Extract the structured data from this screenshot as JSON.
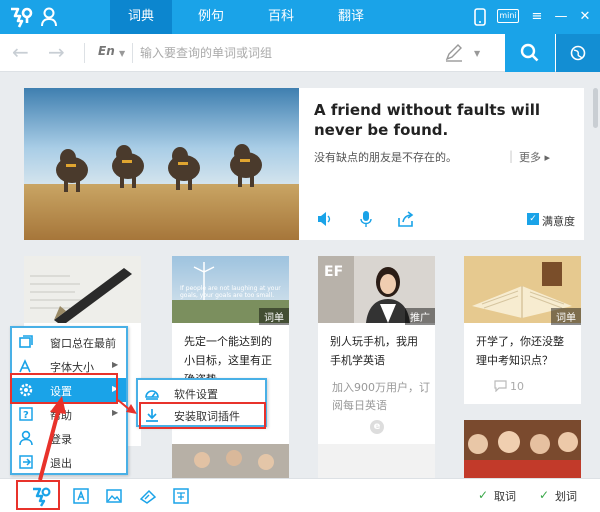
{
  "header": {
    "tabs": [
      {
        "label": "词典",
        "active": true
      },
      {
        "label": "例句",
        "active": false
      },
      {
        "label": "百科",
        "active": false
      },
      {
        "label": "翻译",
        "active": false
      }
    ],
    "mini_label": "mini",
    "minimize": "—",
    "close": "✕",
    "accent": "#1aa3e8"
  },
  "search": {
    "lang": "En",
    "placeholder": "输入要查询的单词或词组"
  },
  "feature": {
    "english": "A friend without faults will never be found.",
    "chinese": "没有缺点的朋友是不存在的。",
    "separator": "|",
    "more": "更多 ▸",
    "satisfaction": "满意度",
    "icons": [
      "speaker-icon",
      "microphone-icon",
      "share-icon"
    ]
  },
  "cards": [
    {
      "tag": "",
      "title": "",
      "sub": "",
      "count": ""
    },
    {
      "tag": "词单",
      "title": "先定一个能达到的小目标，这里有正确姿势",
      "sub": "",
      "count": "",
      "image_text": "If people are not laughing at your goals, your goals are too small."
    },
    {
      "tag": "推广",
      "title": "别人玩手机，我用手机学英语",
      "sub": "加入900万用户，订阅每日英语",
      "count": "",
      "image_text": "EF"
    },
    {
      "tag": "词单",
      "title": "开学了，你还没整理中考知识点？",
      "sub": "",
      "count": "10"
    }
  ],
  "context_menu": {
    "items": [
      {
        "label": "窗口总在最前",
        "icon": "window-icon",
        "arrow": false
      },
      {
        "label": "字体大小",
        "icon": "font-size-icon",
        "arrow": true
      },
      {
        "label": "设置",
        "icon": "gear-icon",
        "arrow": true,
        "highlighted": true
      },
      {
        "label": "帮助",
        "icon": "help-icon",
        "arrow": true
      },
      {
        "label": "登录",
        "icon": "user-icon",
        "arrow": false
      },
      {
        "label": "退出",
        "icon": "exit-icon",
        "arrow": false
      }
    ]
  },
  "submenu": {
    "items": [
      {
        "label": "软件设置",
        "icon": "software-settings-icon"
      },
      {
        "label": "安装取词插件",
        "icon": "download-icon"
      }
    ]
  },
  "bottom": {
    "qu_ci": "取词",
    "hua_ci": "划词",
    "icons": [
      "app-menu-icon",
      "ocr-text-icon",
      "image-translate-icon",
      "word-book-icon",
      "translate-icon"
    ]
  }
}
